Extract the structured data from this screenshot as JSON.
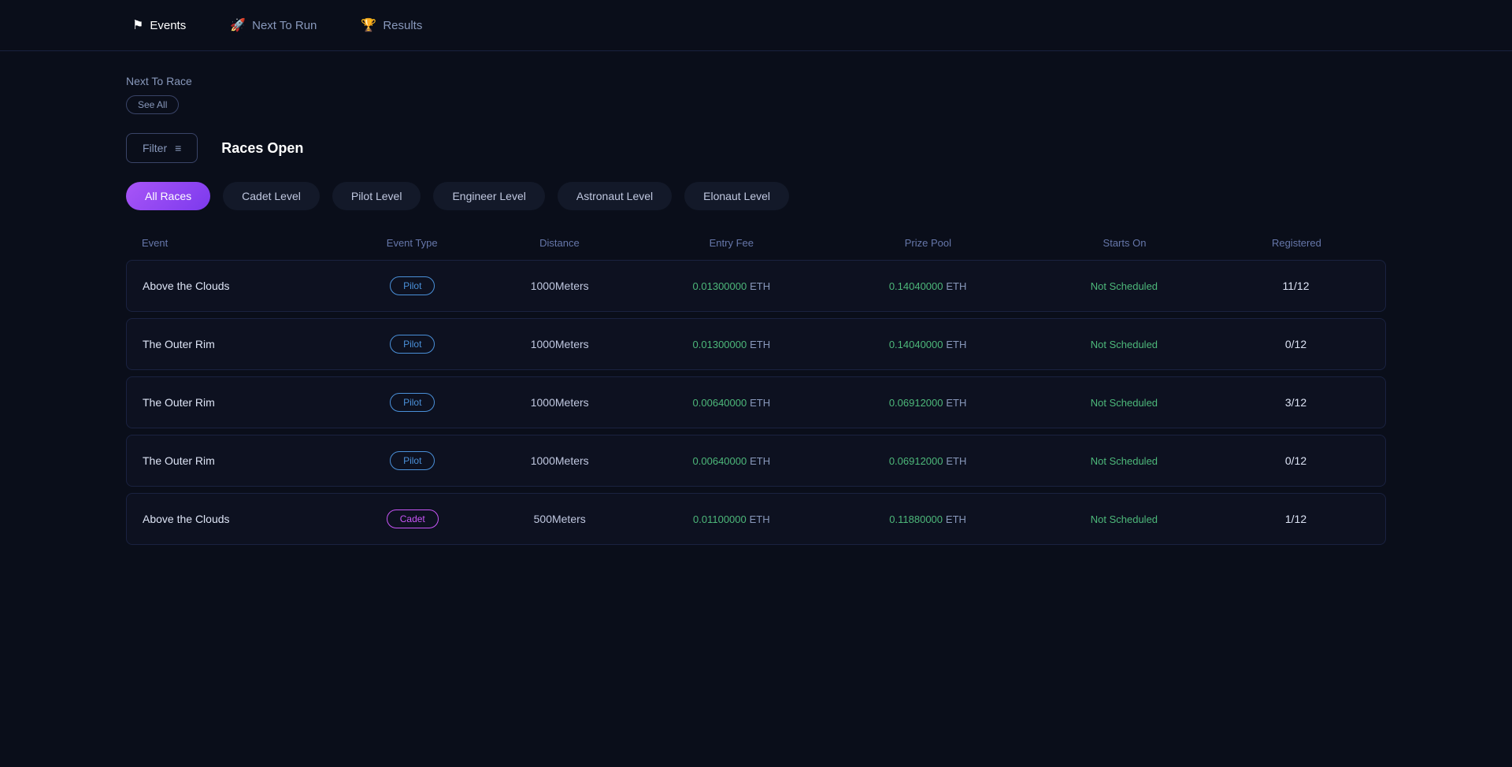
{
  "nav": {
    "items": [
      {
        "id": "events",
        "label": "Events",
        "icon": "⚑",
        "active": true
      },
      {
        "id": "next-to-run",
        "label": "Next To Run",
        "icon": "🚀",
        "active": false
      },
      {
        "id": "results",
        "label": "Results",
        "icon": "🏆",
        "active": false
      }
    ]
  },
  "section": {
    "title": "Next To Race",
    "see_all_label": "See All"
  },
  "filter": {
    "label": "Filter",
    "icon": "≡"
  },
  "races_open_label": "Races Open",
  "level_tabs": [
    {
      "id": "all-races",
      "label": "All Races",
      "active": true
    },
    {
      "id": "cadet-level",
      "label": "Cadet Level",
      "active": false
    },
    {
      "id": "pilot-level",
      "label": "Pilot Level",
      "active": false
    },
    {
      "id": "engineer-level",
      "label": "Engineer Level",
      "active": false
    },
    {
      "id": "astronaut-level",
      "label": "Astronaut Level",
      "active": false
    },
    {
      "id": "elonaut-level",
      "label": "Elonaut Level",
      "active": false
    }
  ],
  "table": {
    "headers": [
      "Event",
      "Event Type",
      "Distance",
      "Entry Fee",
      "Prize Pool",
      "Starts On",
      "Registered"
    ],
    "rows": [
      {
        "event": "Above the Clouds",
        "event_type": "Pilot",
        "event_type_class": "pilot",
        "distance": "1000Meters",
        "entry_fee": "0.01300000",
        "entry_fee_unit": "ETH",
        "prize_pool": "0.14040000",
        "prize_pool_unit": "ETH",
        "starts_on": "Not Scheduled",
        "registered": "11/12"
      },
      {
        "event": "The Outer Rim",
        "event_type": "Pilot",
        "event_type_class": "pilot",
        "distance": "1000Meters",
        "entry_fee": "0.01300000",
        "entry_fee_unit": "ETH",
        "prize_pool": "0.14040000",
        "prize_pool_unit": "ETH",
        "starts_on": "Not Scheduled",
        "registered": "0/12"
      },
      {
        "event": "The Outer Rim",
        "event_type": "Pilot",
        "event_type_class": "pilot",
        "distance": "1000Meters",
        "entry_fee": "0.00640000",
        "entry_fee_unit": "ETH",
        "prize_pool": "0.06912000",
        "prize_pool_unit": "ETH",
        "starts_on": "Not Scheduled",
        "registered": "3/12"
      },
      {
        "event": "The Outer Rim",
        "event_type": "Pilot",
        "event_type_class": "pilot",
        "distance": "1000Meters",
        "entry_fee": "0.00640000",
        "entry_fee_unit": "ETH",
        "prize_pool": "0.06912000",
        "prize_pool_unit": "ETH",
        "starts_on": "Not Scheduled",
        "registered": "0/12"
      },
      {
        "event": "Above the Clouds",
        "event_type": "Cadet",
        "event_type_class": "cadet",
        "distance": "500Meters",
        "entry_fee": "0.01100000",
        "entry_fee_unit": "ETH",
        "prize_pool": "0.11880000",
        "prize_pool_unit": "ETH",
        "starts_on": "Not Scheduled",
        "registered": "1/12"
      }
    ]
  }
}
